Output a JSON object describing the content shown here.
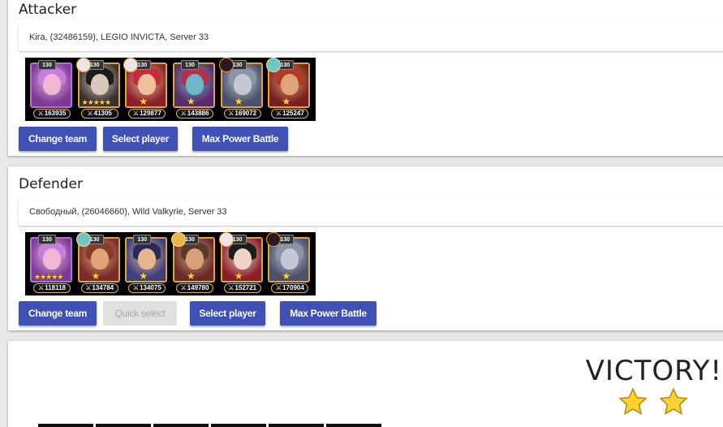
{
  "attacker": {
    "title": "Attacker",
    "info": "Kira, (32486159), LEGIO INVICTA, Server 33",
    "heroes": [
      {
        "level": "130",
        "power": "163935",
        "pet": "none",
        "stars": "",
        "bg": "#7b3a96",
        "skin": "#f0b6d4",
        "hair": "#c77ce0",
        "frame": "purple"
      },
      {
        "level": "130",
        "power": "41305",
        "pet": "cat",
        "stars": "★★★★★",
        "bg": "#3a3030",
        "skin": "#d9c8bc",
        "hair": "#1c1c1c",
        "frame": "gold"
      },
      {
        "level": "130",
        "power": "129877",
        "pet": "cat",
        "stars": "★",
        "bg": "#8a1f2a",
        "skin": "#f0c09a",
        "hair": "#c72a3a",
        "frame": "gold"
      },
      {
        "level": "130",
        "power": "143886",
        "pet": "none",
        "stars": "★",
        "bg": "#5a2a6a",
        "skin": "#6fb7c8",
        "hair": "#b0324b",
        "frame": "gold"
      },
      {
        "level": "130",
        "power": "169072",
        "pet": "dark",
        "stars": "★",
        "bg": "#4a4f6a",
        "skin": "#c4c8d4",
        "hair": "#8c95a8",
        "frame": "gold"
      },
      {
        "level": "130",
        "power": "125247",
        "pet": "cyan",
        "stars": "★",
        "bg": "#7a1e1e",
        "skin": "#e0a478",
        "hair": "#b33a24",
        "frame": "gold"
      }
    ],
    "buttons": {
      "change_team": "Change team",
      "select_player": "Select player",
      "max_power": "Max Power Battle"
    }
  },
  "defender": {
    "title": "Defender",
    "info": "Свободный, (26046660), Wild Valkyrie, Server 33",
    "heroes": [
      {
        "level": "130",
        "power": "118118",
        "pet": "none",
        "stars": "★★★★★",
        "bg": "#7b3a96",
        "skin": "#f0b6d4",
        "hair": "#c77ce0",
        "frame": "purple"
      },
      {
        "level": "130",
        "power": "134784",
        "pet": "cyan",
        "stars": "★",
        "bg": "#7a2a2a",
        "skin": "#e0a478",
        "hair": "#8a3a2a",
        "frame": "gold"
      },
      {
        "level": "130",
        "power": "134075",
        "pet": "none",
        "stars": "★",
        "bg": "#3b3f7a",
        "skin": "#e6b48f",
        "hair": "#2a2a5a",
        "frame": "gold"
      },
      {
        "level": "130",
        "power": "149780",
        "pet": "gold",
        "stars": "★",
        "bg": "#6a2a2a",
        "skin": "#d8a07a",
        "hair": "#5a3a2a",
        "frame": "gold"
      },
      {
        "level": "130",
        "power": "152721",
        "pet": "cat",
        "stars": "★",
        "bg": "#8a1f2a",
        "skin": "#f0d4c8",
        "hair": "#1c1c1c",
        "frame": "gold"
      },
      {
        "level": "130",
        "power": "170904",
        "pet": "dark",
        "stars": "★",
        "bg": "#4a4f6a",
        "skin": "#c4c8d4",
        "hair": "#8c95a8",
        "frame": "gold"
      }
    ],
    "buttons": {
      "change_team": "Change team",
      "quick_select": "Quick select",
      "select_player": "Select player",
      "max_power": "Max Power Battle"
    }
  },
  "result": {
    "title": "VICTORY!",
    "stars_earned": 2
  },
  "colors": {
    "button_primary": "#3f51b5",
    "button_disabled": "#e0e0e0",
    "star_gold": "#ffd22e"
  }
}
